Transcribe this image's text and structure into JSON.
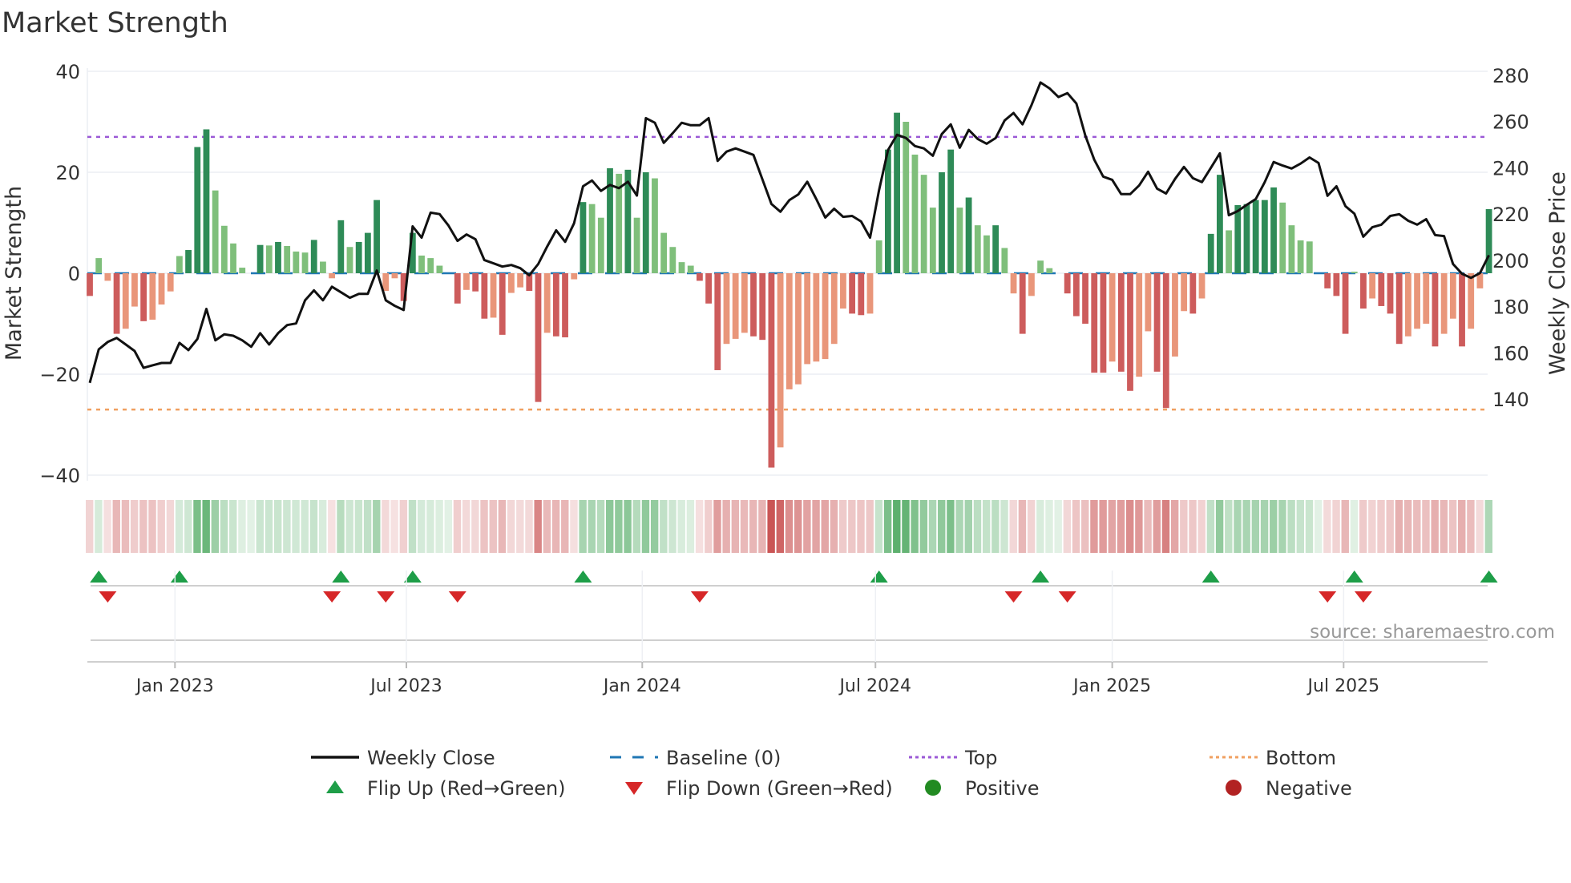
{
  "chart_data": {
    "type": "bar",
    "title": "Market Strength",
    "ylabel": "Market Strength",
    "y2label": "Weekly Close Price",
    "ylim": [
      -40,
      40
    ],
    "y2lim": [
      140,
      280
    ],
    "yticks": [
      "40",
      "20",
      "0",
      "−20",
      "−40"
    ],
    "yticks_values": [
      40,
      20,
      0,
      -20,
      -40
    ],
    "y2ticks": [
      "280",
      "260",
      "240",
      "220",
      "200",
      "180",
      "160",
      "140"
    ],
    "y2ticks_values": [
      280,
      260,
      240,
      220,
      200,
      180,
      160,
      140
    ],
    "top_level": 27,
    "bottom_level": -27,
    "baseline": 0,
    "grid": true,
    "x_unit": "week index",
    "xticks": [
      {
        "label": "Jan 2023",
        "week": 9.5
      },
      {
        "label": "Jul 2023",
        "week": 35.3
      },
      {
        "label": "Jan 2024",
        "week": 61.6
      },
      {
        "label": "Jul 2024",
        "week": 87.6
      },
      {
        "label": "Jan 2025",
        "week": 114
      },
      {
        "label": "Jul 2025",
        "week": 139.8
      }
    ],
    "strength": [
      -4.5,
      3,
      -1.5,
      -12,
      -11,
      -6.6,
      -9.5,
      -9.2,
      -6.2,
      -3.6,
      3.4,
      4.6,
      25,
      28.5,
      16.4,
      9.4,
      5.9,
      1.1,
      0,
      5.6,
      5.5,
      6.2,
      5.4,
      4.3,
      4.1,
      6.6,
      2.3,
      -1,
      10.5,
      5.2,
      6.2,
      8,
      14.5,
      -3.5,
      -1,
      -5.5,
      8,
      3.5,
      3,
      1.5,
      0,
      -6,
      -3.3,
      -3.6,
      -9,
      -8.8,
      -12.2,
      -3.9,
      -2.8,
      -3.5,
      -25.5,
      -11.8,
      -12.5,
      -12.7,
      -1.2,
      14.1,
      13.7,
      11,
      20.8,
      19.7,
      20.5,
      11,
      20,
      18.8,
      8,
      5.2,
      2.2,
      1.5,
      -1.5,
      -6,
      -19.2,
      -14,
      -13,
      -11.8,
      -12.5,
      -13.2,
      -38.5,
      -34.5,
      -23,
      -22,
      -18,
      -17.5,
      -17,
      -14,
      -7,
      -8,
      -8.3,
      -8,
      6.5,
      24.5,
      31.8,
      30,
      23.5,
      19.5,
      13,
      20,
      24.5,
      13,
      15,
      9.5,
      7.5,
      9.5,
      5,
      -4,
      -12,
      -4.5,
      2.5,
      1,
      0,
      -4,
      -8.5,
      -10,
      -19.7,
      -19.7,
      -17.5,
      -19.5,
      -23.3,
      -20.5,
      -11.5,
      -19.5,
      -26.7,
      -16.5,
      -7.5,
      -8,
      -5,
      7.8,
      19.5,
      8.5,
      13.5,
      13.7,
      14.5,
      14.5,
      17,
      14,
      9.5,
      6.5,
      6.3,
      0,
      -3,
      -4.5,
      -12,
      0.3,
      -7,
      -5,
      -6.5,
      -8,
      -14,
      -12.5,
      -11,
      -10,
      -14.5,
      -12,
      -9,
      -14.5,
      -11,
      -3,
      12.7
    ],
    "weekly_close": [
      147,
      161.5,
      164.7,
      166.4,
      163.6,
      160.8,
      153.5,
      154.6,
      155.6,
      155.6,
      164.3,
      161.2,
      166,
      179,
      165.4,
      168,
      167.4,
      165.4,
      162.6,
      168.5,
      163.6,
      168.5,
      172,
      172.7,
      182.7,
      187,
      182.7,
      188.6,
      186.2,
      183.8,
      185.5,
      185.5,
      195.6,
      182.7,
      180.3,
      178.5,
      214.7,
      209.8,
      220.6,
      220,
      215,
      208.4,
      211.2,
      209.1,
      200.1,
      198.7,
      197.3,
      198,
      196.6,
      193.5,
      198.4,
      206,
      213,
      208,
      216,
      232,
      234.5,
      230,
      232.6,
      231.2,
      234,
      228,
      261.5,
      259.5,
      250.8,
      255,
      259.5,
      258.4,
      258.4,
      261.5,
      243,
      247,
      248.4,
      247,
      245.6,
      235,
      224.4,
      221,
      226,
      228.5,
      234,
      226.5,
      218.5,
      222.3,
      218.8,
      219.2,
      216.8,
      209.8,
      230.3,
      247.7,
      254.3,
      252.9,
      249.4,
      248.4,
      245.2,
      254.6,
      258.8,
      248.7,
      256.4,
      252.5,
      250.4,
      252.9,
      260.5,
      263.7,
      258.8,
      267.1,
      276.9,
      274.4,
      270.6,
      272.3,
      267.8,
      253.9,
      243.5,
      236.2,
      234.8,
      228.6,
      228.6,
      232.4,
      238.3,
      231,
      228.9,
      235.2,
      240.4,
      235.5,
      233.8,
      240,
      246.3,
      219.5,
      221.3,
      224,
      226.5,
      233.8,
      242.5,
      241,
      239.7,
      241.8,
      244.5,
      242.1,
      227.9,
      232,
      223.4,
      220.2,
      210.2,
      214.3,
      215.4,
      219.2,
      219.9,
      217.1,
      215.4,
      217.8,
      210.9,
      210.5,
      198.4,
      194.2,
      192.4,
      194.5,
      202.2
    ],
    "flip_up_weeks": [
      1,
      10,
      28,
      36,
      55,
      88,
      106,
      125,
      141,
      156
    ],
    "flip_down_weeks": [
      2,
      27,
      33,
      41,
      68,
      103,
      109,
      138,
      142
    ],
    "legend": {
      "placement": "bottom",
      "entries": [
        "Weekly Close",
        "Baseline (0)",
        "Top",
        "Bottom",
        "Flip Up (Red→Green)",
        "Flip Down (Green→Red)",
        "Positive",
        "Negative"
      ]
    },
    "source": "source: sharemaestro.com"
  },
  "colors": {
    "strong_positive": "#2e8b57",
    "weak_positive": "#7fbf7b",
    "strong_negative": "#cd5c5c",
    "weak_negative": "#e9967a",
    "line": "#111111",
    "baseline": "#1f77b4",
    "top": "#9b59d6",
    "bottom": "#f0a060",
    "flip_up": "#1e9e48",
    "flip_down": "#d62728",
    "positive": "#228b22",
    "negative": "#b22222"
  }
}
